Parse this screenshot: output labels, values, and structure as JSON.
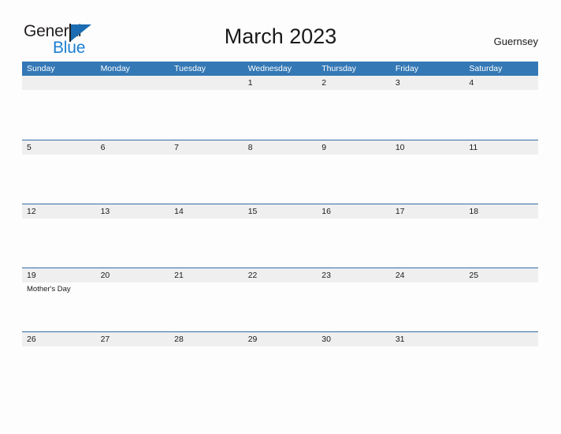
{
  "logo": {
    "word_one": "General",
    "word_two": "Blue",
    "flag_icon": "blue-triangle-flag",
    "brand_blue": "#1b7fd4",
    "flag_blue": "#1b6cb2"
  },
  "header": {
    "title": "March 2023",
    "locale": "Guernsey"
  },
  "colors": {
    "header_blue": "#3478b5",
    "row_rule_blue": "#2f6ea8",
    "date_band_gray": "#efefef",
    "page_background": "#fdfdfd",
    "text_dark": "#1a1a1a"
  },
  "calendar": {
    "day_headers": [
      "Sunday",
      "Monday",
      "Tuesday",
      "Wednesday",
      "Thursday",
      "Friday",
      "Saturday"
    ],
    "weeks": [
      {
        "days": [
          {
            "date": "",
            "events": []
          },
          {
            "date": "",
            "events": []
          },
          {
            "date": "",
            "events": []
          },
          {
            "date": "1",
            "events": []
          },
          {
            "date": "2",
            "events": []
          },
          {
            "date": "3",
            "events": []
          },
          {
            "date": "4",
            "events": []
          }
        ]
      },
      {
        "days": [
          {
            "date": "5",
            "events": []
          },
          {
            "date": "6",
            "events": []
          },
          {
            "date": "7",
            "events": []
          },
          {
            "date": "8",
            "events": []
          },
          {
            "date": "9",
            "events": []
          },
          {
            "date": "10",
            "events": []
          },
          {
            "date": "11",
            "events": []
          }
        ]
      },
      {
        "days": [
          {
            "date": "12",
            "events": []
          },
          {
            "date": "13",
            "events": []
          },
          {
            "date": "14",
            "events": []
          },
          {
            "date": "15",
            "events": []
          },
          {
            "date": "16",
            "events": []
          },
          {
            "date": "17",
            "events": []
          },
          {
            "date": "18",
            "events": []
          }
        ]
      },
      {
        "days": [
          {
            "date": "19",
            "events": [
              "Mother's Day"
            ]
          },
          {
            "date": "20",
            "events": []
          },
          {
            "date": "21",
            "events": []
          },
          {
            "date": "22",
            "events": []
          },
          {
            "date": "23",
            "events": []
          },
          {
            "date": "24",
            "events": []
          },
          {
            "date": "25",
            "events": []
          }
        ]
      },
      {
        "days": [
          {
            "date": "26",
            "events": []
          },
          {
            "date": "27",
            "events": []
          },
          {
            "date": "28",
            "events": []
          },
          {
            "date": "29",
            "events": []
          },
          {
            "date": "30",
            "events": []
          },
          {
            "date": "31",
            "events": []
          },
          {
            "date": "",
            "events": []
          }
        ]
      }
    ]
  }
}
